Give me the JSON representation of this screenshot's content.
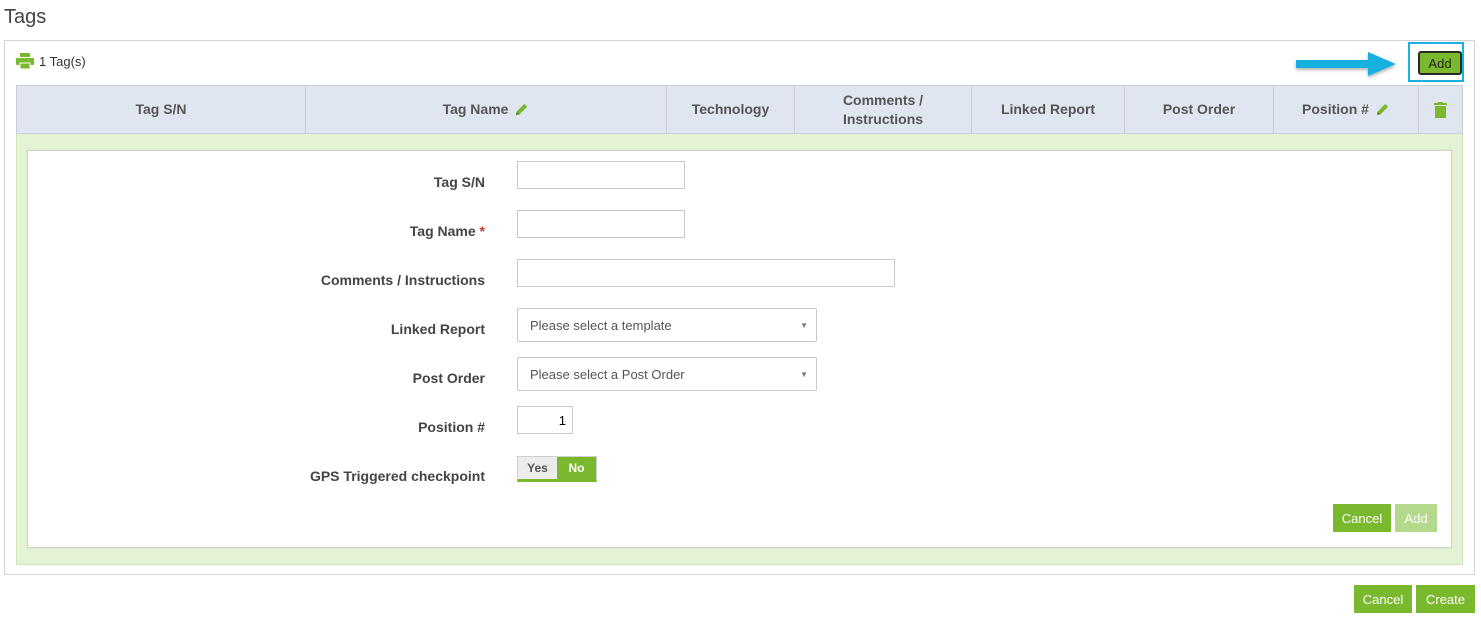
{
  "page": {
    "title": "Tags"
  },
  "toolbar": {
    "count_label": "1 Tag(s)",
    "print_icon": "print-icon",
    "add_label": "Add"
  },
  "colors": {
    "accent": "#7ab82e",
    "header_bg": "#dfe6ef",
    "edit_bg": "#e4f3d4",
    "highlight": "#19b1e0",
    "required": "#c0392b"
  },
  "grid": {
    "columns": [
      {
        "label": "Tag S/N",
        "icon": ""
      },
      {
        "label": "Tag Name",
        "icon": "pencil-icon"
      },
      {
        "label": "Technology",
        "icon": ""
      },
      {
        "label": "Comments / Instructions",
        "icon": ""
      },
      {
        "label": "Linked Report",
        "icon": ""
      },
      {
        "label": "Post Order",
        "icon": ""
      },
      {
        "label": "Position #",
        "icon": "pencil-icon"
      },
      {
        "label": "",
        "icon": "trash-icon"
      }
    ]
  },
  "form": {
    "tag_sn": {
      "label": "Tag S/N",
      "value": ""
    },
    "tag_name": {
      "label": "Tag Name",
      "required_mark": "*",
      "value": ""
    },
    "comments": {
      "label": "Comments / Instructions",
      "value": ""
    },
    "linked_report": {
      "label": "Linked Report",
      "placeholder": "Please select a template"
    },
    "post_order": {
      "label": "Post Order",
      "placeholder": "Please select a Post Order"
    },
    "position": {
      "label": "Position #",
      "value": "1"
    },
    "gps": {
      "label": "GPS Triggered checkpoint",
      "yes_label": "Yes",
      "no_label": "No",
      "selected": "No"
    },
    "cancel_label": "Cancel",
    "add_label": "Add"
  },
  "footer": {
    "cancel_label": "Cancel",
    "create_label": "Create"
  }
}
